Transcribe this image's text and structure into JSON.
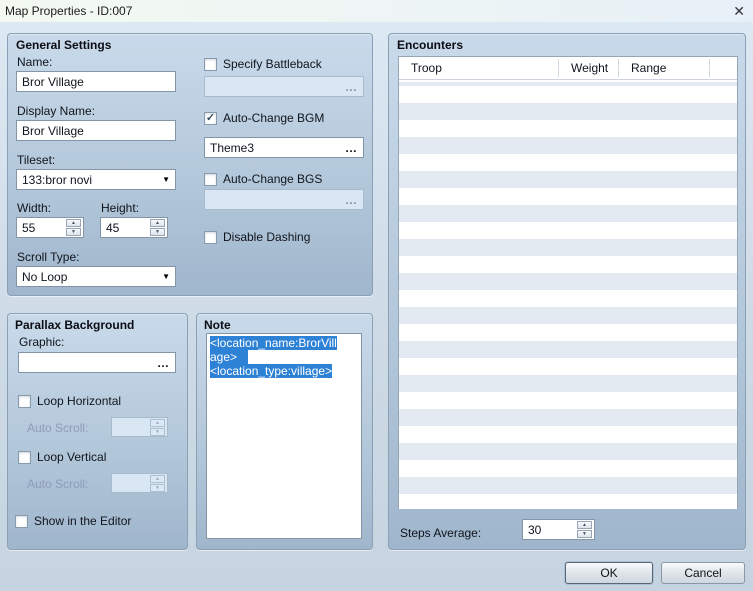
{
  "window": {
    "title": "Map Properties - ID:007",
    "close_icon": "✕"
  },
  "general": {
    "heading": "General Settings",
    "name_label": "Name:",
    "name_value": "Bror Village",
    "display_name_label": "Display Name:",
    "display_name_value": "Bror Village",
    "tileset_label": "Tileset:",
    "tileset_value": "133:bror novi",
    "width_label": "Width:",
    "width_value": "55",
    "height_label": "Height:",
    "height_value": "45",
    "scroll_type_label": "Scroll Type:",
    "scroll_type_value": "No Loop",
    "specify_battleback_label": "Specify Battleback",
    "battleback_value": "",
    "auto_change_bgm_label": "Auto-Change BGM",
    "bgm_value": "Theme3",
    "auto_change_bgs_label": "Auto-Change BGS",
    "bgs_value": "",
    "disable_dashing_label": "Disable Dashing",
    "ellipsis": "…"
  },
  "parallax": {
    "heading": "Parallax Background",
    "graphic_label": "Graphic:",
    "graphic_value": "",
    "loop_horizontal_label": "Loop Horizontal",
    "auto_scroll_label": "Auto Scroll:",
    "auto_scroll_value": "",
    "loop_vertical_label": "Loop Vertical",
    "auto_scroll2_label": "Auto Scroll:",
    "auto_scroll2_value": "",
    "show_in_editor_label": "Show in the Editor"
  },
  "note": {
    "heading": "Note",
    "lines": [
      "<location_name:BrorVill",
      "age>",
      "<location_type:village>"
    ]
  },
  "encounters": {
    "heading": "Encounters",
    "columns": [
      "Troop",
      "Weight",
      "Range",
      ""
    ],
    "rows": [],
    "steps_average_label": "Steps Average:",
    "steps_average_value": "30"
  },
  "buttons": {
    "ok": "OK",
    "cancel": "Cancel"
  },
  "colors": {
    "selection_blue": "#2e82d5",
    "row_stripe": "#e4eaf1",
    "panel_top": "#c8daea",
    "panel_bottom": "#a0b6cc"
  }
}
